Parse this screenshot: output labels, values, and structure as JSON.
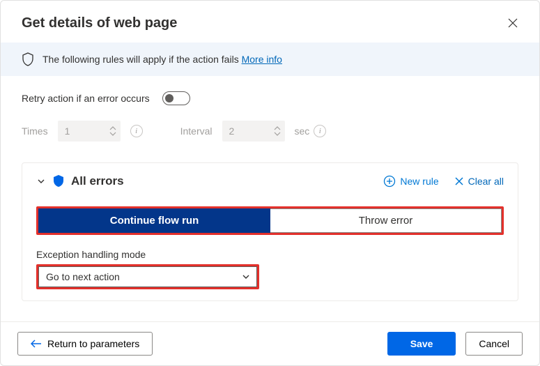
{
  "header": {
    "title": "Get details of web page"
  },
  "notice": {
    "text": "The following rules will apply if the action fails",
    "link": "More info"
  },
  "retry": {
    "label": "Retry action if an error occurs",
    "times_label": "Times",
    "times_value": "1",
    "interval_label": "Interval",
    "interval_value": "2",
    "unit": "sec"
  },
  "errors": {
    "heading": "All errors",
    "new_rule": "New rule",
    "clear_all": "Clear all",
    "seg_continue": "Continue flow run",
    "seg_throw": "Throw error",
    "mode_label": "Exception handling mode",
    "mode_value": "Go to next action"
  },
  "footer": {
    "return": "Return to parameters",
    "save": "Save",
    "cancel": "Cancel"
  }
}
